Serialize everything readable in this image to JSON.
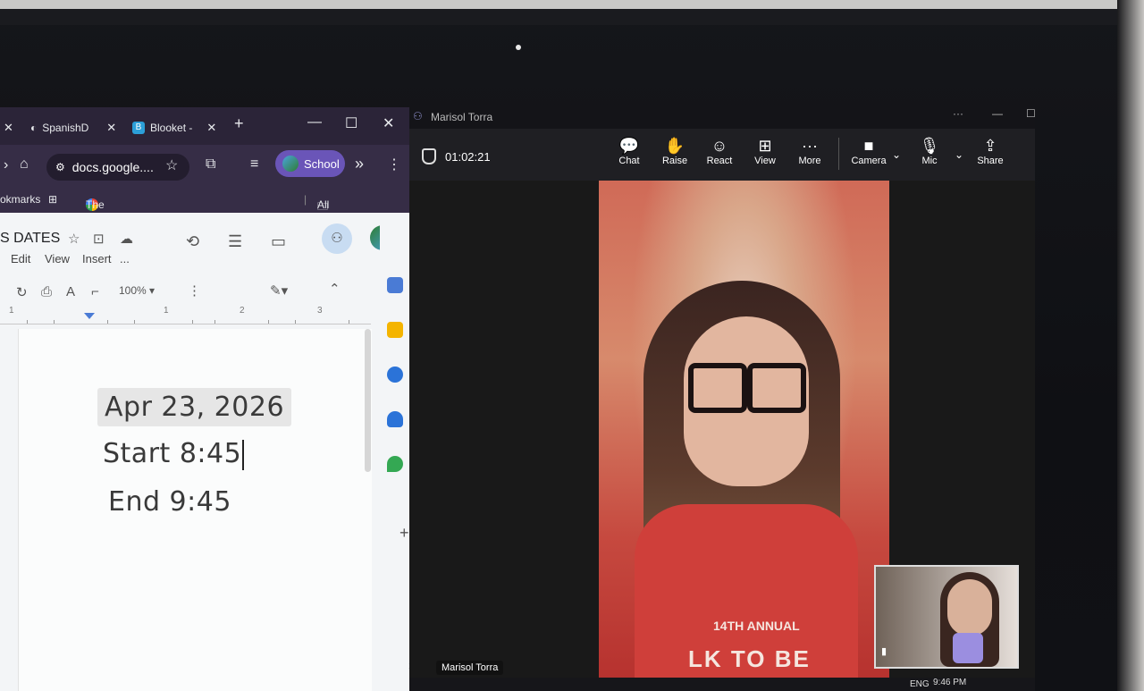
{
  "chrome": {
    "tabs": [
      {
        "label": "SpanishD",
        "icon": "spanishdict-icon"
      },
      {
        "label": "Blooket -",
        "icon": "blooket-icon"
      }
    ],
    "new_tab_label": "+",
    "address": "docs.google....",
    "profile_chip": "School",
    "bookmarks_bar": {
      "left_label": "okmarks",
      "item": "The Newspaper Cut...",
      "all_bookmarks": "All Bookmarks"
    }
  },
  "docs": {
    "title": "S DATES",
    "menu": [
      "Edit",
      "View",
      "Insert",
      "..."
    ],
    "zoom": "100%",
    "ruler_numbers": [
      "1",
      "1",
      "2",
      "3"
    ],
    "lines": [
      "Apr 23, 2026",
      "Start 8:45",
      "End 9:45"
    ]
  },
  "teams": {
    "window_title": "Marisol Torra",
    "timer": "01:02:21",
    "controls": [
      "Chat",
      "Raise",
      "React",
      "View",
      "More",
      "Camera",
      "Mic",
      "Share"
    ],
    "participant_name": "Marisol Torra",
    "shirt_text_1": "14TH ANNUAL",
    "shirt_text_2": "LK TO BE"
  },
  "taskbar": {
    "language": "ENG",
    "time": "9:46 PM"
  }
}
